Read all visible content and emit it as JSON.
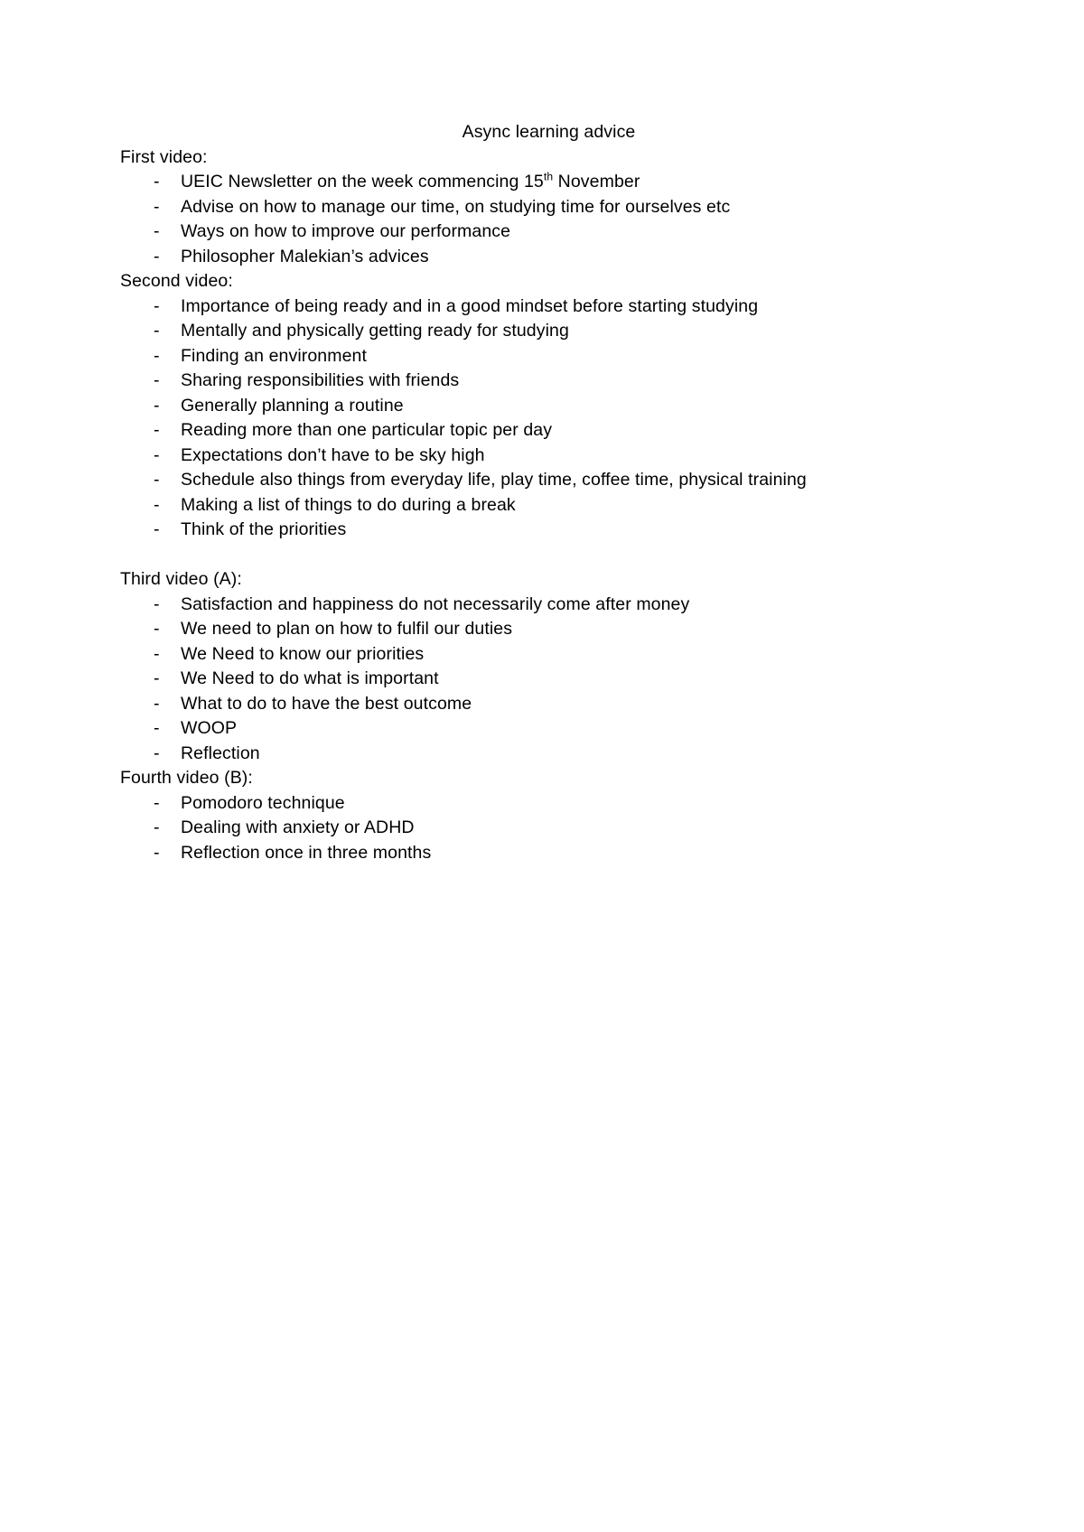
{
  "document": {
    "title": "Async learning advice",
    "sections": [
      {
        "heading": "First video:",
        "items": [
          {
            "text_before": "UEIC Newsletter on the week commencing 15",
            "sup": "th",
            "text_after": " November"
          },
          {
            "text": "Advise on how to manage our time, on studying time for ourselves etc"
          },
          {
            "text": "Ways on how to improve our performance"
          },
          {
            "text": "Philosopher Malekian’s advices"
          }
        ]
      },
      {
        "heading": "Second video:",
        "items": [
          {
            "text": "Importance of being ready and in a good mindset before starting studying"
          },
          {
            "text": "Mentally and physically getting ready for studying"
          },
          {
            "text": "Finding an environment"
          },
          {
            "text": "Sharing responsibilities with friends"
          },
          {
            "text": "Generally planning a routine"
          },
          {
            "text": "Reading more than one particular topic per day"
          },
          {
            "text": "Expectations don’t have to be sky high"
          },
          {
            "text": "Schedule also things from everyday life, play time, coffee time, physical training"
          },
          {
            "text": "Making a list of things to do during a break"
          },
          {
            "text": "Think of the priorities"
          }
        ],
        "blank_line_after": true
      },
      {
        "heading": "Third video (A):",
        "items": [
          {
            "text": "Satisfaction and happiness do not necessarily come after money"
          },
          {
            "text": "We need to plan on how to fulfil our duties"
          },
          {
            "text": "We Need to know our priorities"
          },
          {
            "text": "We Need to do what is important"
          },
          {
            "text": "What to do to have the best outcome"
          },
          {
            "text": "WOOP"
          },
          {
            "text": "Reflection"
          }
        ]
      },
      {
        "heading": "Fourth video (B):",
        "items": [
          {
            "text": "Pomodoro technique"
          },
          {
            "text": "Dealing with anxiety or ADHD"
          },
          {
            "text": "Reflection once in three months"
          }
        ]
      }
    ],
    "bullet_marker": "-"
  }
}
